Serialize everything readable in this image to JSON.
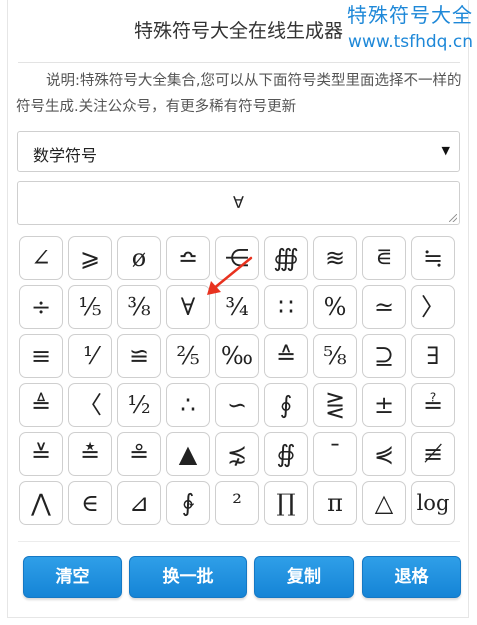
{
  "page": {
    "title": "特殊符号大全在线生成器",
    "description": "说明:特殊符号大全集合,您可以从下面符号类型里面选择不一样的符号生成.关注公众号，有更多稀有符号更新"
  },
  "watermark": {
    "line1": "特殊符号大全",
    "line2": "www.tsfhdq.cn"
  },
  "category_select": {
    "selected": "数学符号"
  },
  "output": {
    "value": "∀"
  },
  "symbols": [
    "∠",
    "⩾",
    "ø",
    "≏",
    "⋲",
    "∰",
    "≋",
    "⋷",
    "≒",
    "÷",
    "⅕",
    "⅜",
    "∀",
    "¾",
    "∷",
    "%",
    "≃",
    "〉",
    "≡",
    "⅟",
    "≌",
    "⅖",
    "‰",
    "≙",
    "⅝",
    "⊇",
    "∃",
    "≜",
    "〈",
    "½",
    "∴",
    "∽",
    "∮",
    "⋛",
    "±",
    "≟",
    "≚",
    "≛",
    "≗",
    "▲",
    "⋨",
    "∯",
    "ˉ",
    "⋞",
    "≢",
    "⋀",
    "∈",
    "⊿",
    "∲",
    "²",
    "∏",
    "π",
    "△",
    "log"
  ],
  "buttons": {
    "clear": "清空",
    "next_batch": "换一批",
    "copy": "复制",
    "backspace": "退格"
  },
  "colors": {
    "accent": "#1e88d8",
    "button": "#1a8fe0",
    "arrow": "#e8321f"
  }
}
